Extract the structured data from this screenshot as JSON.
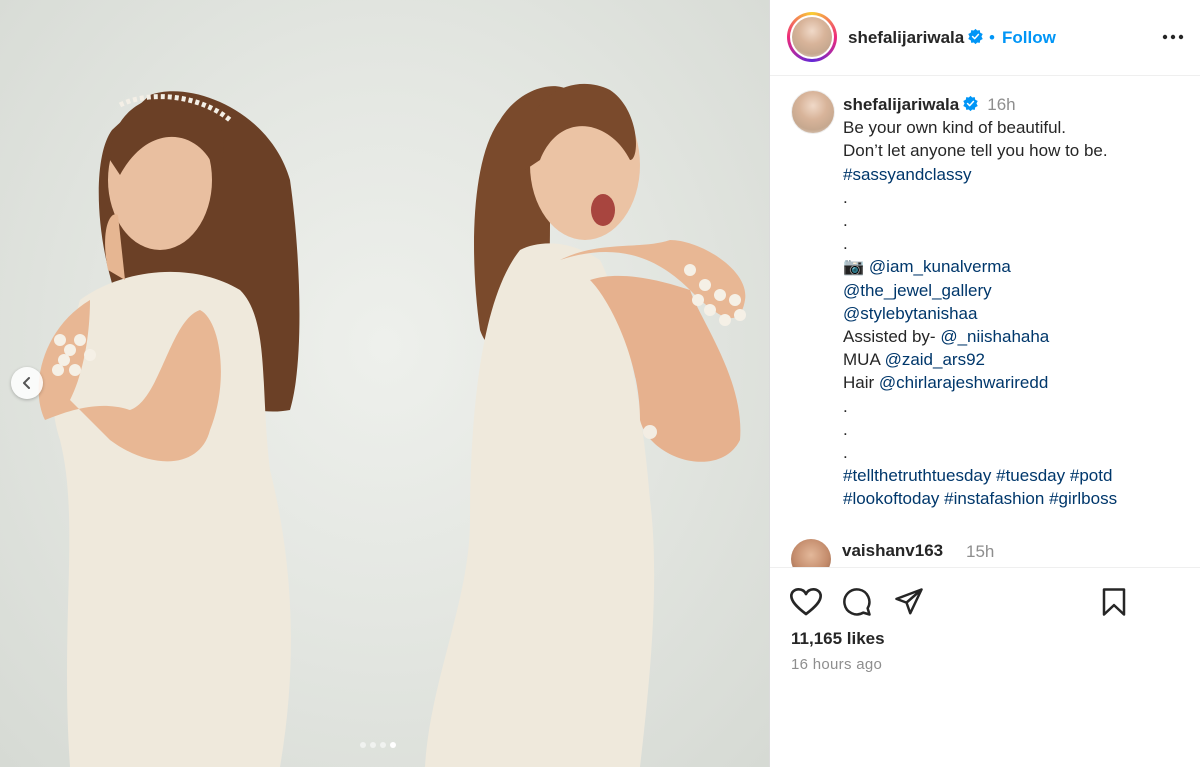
{
  "post": {
    "username": "shefalijariwala",
    "follow_separator": "•",
    "follow_label": "Follow",
    "carousel": {
      "slide_count": 4,
      "active_index": 3
    }
  },
  "caption": {
    "username": "shefalijariwala",
    "time": "16h",
    "lines": [
      {
        "text": "Be your own kind of beautiful."
      },
      {
        "text": "Don’t let anyone tell you how to be."
      }
    ],
    "hashtag_1": "#sassyandclassy",
    "dot": ".",
    "camera_emoji": "📷",
    "mentions": {
      "photographer": "@iam_kunalverma",
      "jewel": "@the_jewel_gallery",
      "style": "@stylebytanishaa",
      "assisted_prefix": "Assisted by- ",
      "assisted": "@_niishahaha",
      "mua_prefix": "MUA ",
      "mua": "@zaid_ars92",
      "hair_prefix": "Hair ",
      "hair": "@chirlarajeshwariredd"
    },
    "hashtags_line1": [
      "#tellthetruthtuesday",
      "#tuesday",
      "#potd"
    ],
    "hashtags_line2": [
      "#lookoftoday",
      "#instafashion",
      "#girlboss"
    ]
  },
  "comment": {
    "username": "vaishanv163",
    "time": "15h"
  },
  "stats": {
    "likes": "11,165 likes",
    "posted": "16 hours ago"
  },
  "colors": {
    "link": "#00376b",
    "follow": "#0095f6",
    "verified": "#0095f6"
  },
  "icons": [
    "chevron-left-icon",
    "heart-icon",
    "comment-icon",
    "share-icon",
    "bookmark-icon",
    "more-icon",
    "verified-icon"
  ]
}
